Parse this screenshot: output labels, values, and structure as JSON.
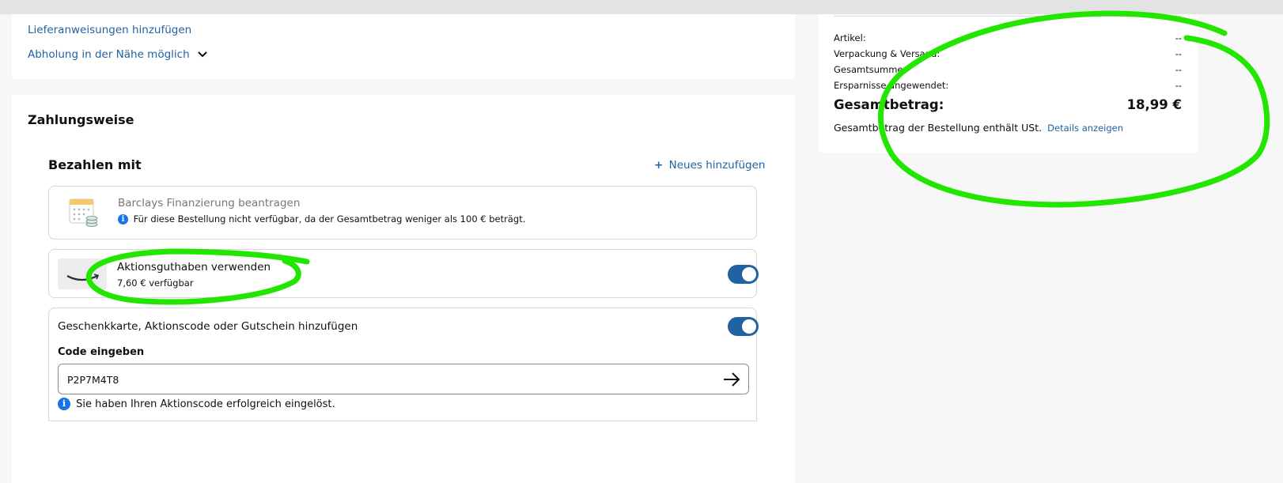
{
  "delivery": {
    "instructions_link": "Lieferanweisungen hinzufügen",
    "pickup_link": "Abholung in der Nähe möglich"
  },
  "payment": {
    "title": "Zahlungsweise",
    "pay_with_heading": "Bezahlen mit",
    "add_new_link": "Neues hinzufügen",
    "add_new_icon": "+",
    "barclays": {
      "title": "Barclays Finanzierung beantragen",
      "info": "Für diese Bestellung nicht verfügbar, da der Gesamtbetrag weniger als 100 € beträgt."
    },
    "promo_balance": {
      "title": "Aktionsguthaben verwenden",
      "available": "7,60 € verfügbar",
      "enabled": true
    },
    "gift_card": {
      "title": "Geschenkkarte, Aktionscode oder Gutschein hinzufügen",
      "enabled": true,
      "code_label": "Code eingeben",
      "code_value": "P2P7M4T8",
      "success_message": "Sie haben Ihren Aktionscode erfolgreich eingelöst."
    }
  },
  "summary": {
    "rows": [
      {
        "label": "Artikel:",
        "value": "--"
      },
      {
        "label": "Verpackung & Versand:",
        "value": "--"
      },
      {
        "label": "Gesamtsumme:",
        "value": "--"
      },
      {
        "label": "Ersparnisse angewendet:",
        "value": "--"
      }
    ],
    "total_label": "Gesamtbetrag:",
    "total_value": "18,99 €",
    "vat_note": "Gesamtbetrag der Bestellung enthält USt.",
    "details_link": "Details anzeigen"
  },
  "annotation_color": "#22e600"
}
